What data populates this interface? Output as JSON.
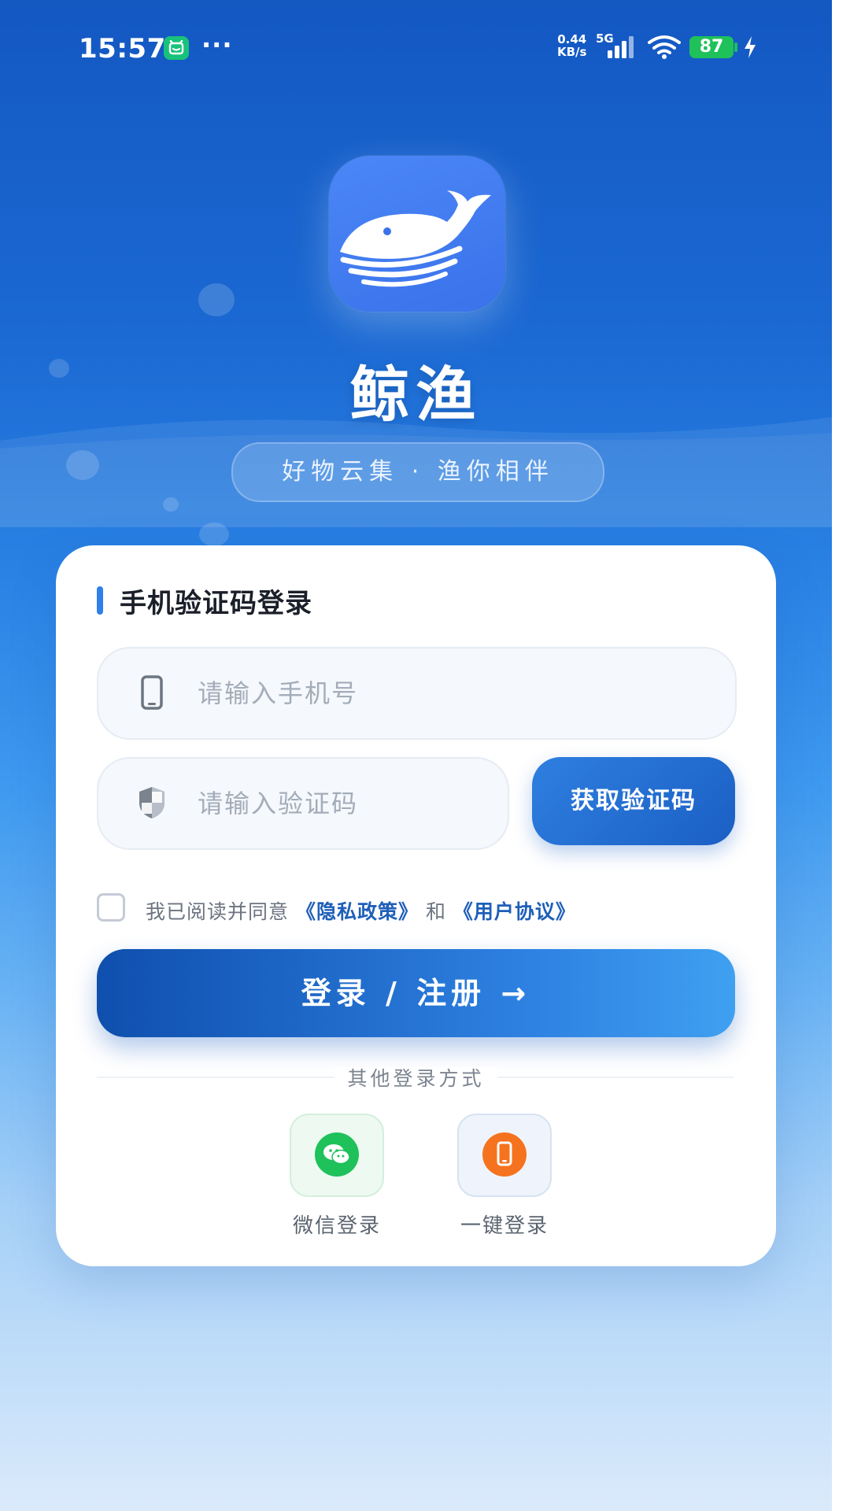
{
  "status_bar": {
    "time": "15:57",
    "more": "···",
    "net_speed_value": "0.44",
    "net_speed_unit": "KB/s",
    "network": "5G",
    "battery": "87"
  },
  "header": {
    "app_name": "鲸渔",
    "slogan": "好物云集 · 渔你相伴"
  },
  "login_card": {
    "title": "手机验证码登录",
    "phone_placeholder": "请输入手机号",
    "code_placeholder": "请输入验证码",
    "get_code_label": "获取验证码",
    "agree_prefix": "我已阅读并同意",
    "privacy_link": "《隐私政策》",
    "agree_and": "和",
    "terms_link": "《用户协议》",
    "login_label": "登录 / 注册 →",
    "other_methods": "其他登录方式",
    "wechat_label": "微信登录",
    "onekey_label": "一键登录"
  },
  "colors": {
    "brand_blue": "#1b69d3",
    "wechat_green": "#1fc15a",
    "onekey_orange": "#f5731e"
  },
  "icons": [
    "wechat-icon",
    "phone-icon",
    "shield-icon",
    "whale-logo-icon",
    "signal-icon",
    "wifi-icon",
    "battery-icon",
    "charging-icon"
  ]
}
